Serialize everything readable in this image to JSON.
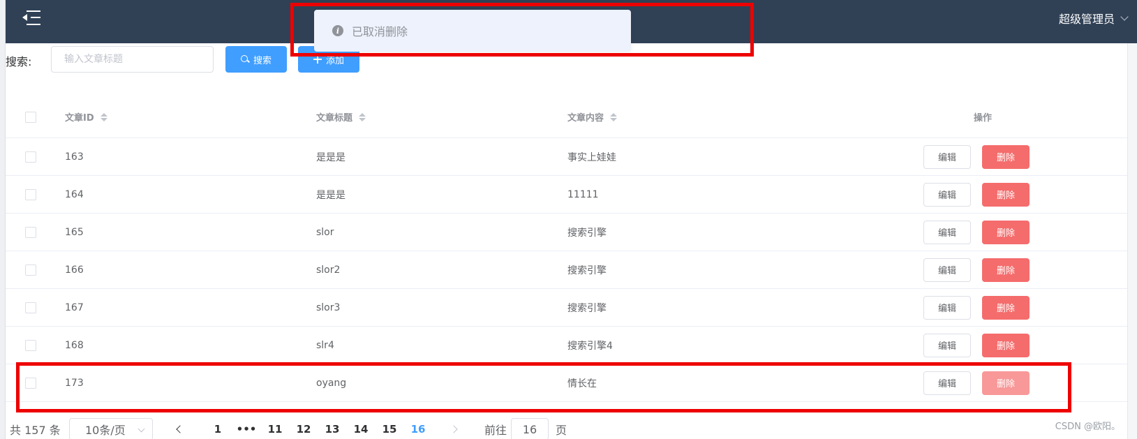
{
  "header": {
    "user_name": "超级管理员"
  },
  "toolbar": {
    "search_label": "搜索:",
    "search_placeholder": "输入文章标题",
    "search_button": "搜索",
    "add_button": "添加"
  },
  "toast": {
    "message": "已取消删除",
    "icon": "info-icon"
  },
  "table": {
    "columns": {
      "id": "文章ID",
      "title": "文章标题",
      "content": "文章内容",
      "ops": "操作"
    },
    "edit_label": "编辑",
    "delete_label": "删除",
    "rows": [
      {
        "id": "163",
        "title": "是是是",
        "content": "事实上娃娃"
      },
      {
        "id": "164",
        "title": "是是是",
        "content": "11111"
      },
      {
        "id": "165",
        "title": "slor",
        "content": "搜索引擎"
      },
      {
        "id": "166",
        "title": "slor2",
        "content": "搜索引擎"
      },
      {
        "id": "167",
        "title": "slor3",
        "content": "搜索引擎"
      },
      {
        "id": "168",
        "title": "slr4",
        "content": "搜索引擎4"
      },
      {
        "id": "173",
        "title": "oyang",
        "content": "情长在"
      }
    ]
  },
  "pagination": {
    "total_text": "共 157 条",
    "page_size": "10条/页",
    "pages": [
      "1",
      "•••",
      "11",
      "12",
      "13",
      "14",
      "15",
      "16"
    ],
    "current_page": "16",
    "goto_label": "前往",
    "goto_value": "16",
    "goto_suffix": "页"
  },
  "watermark": "CSDN @欧阳。",
  "colors": {
    "header_bg": "#304156",
    "primary": "#409eff",
    "danger": "#f56c6c",
    "highlight_frame": "#ee0000"
  }
}
